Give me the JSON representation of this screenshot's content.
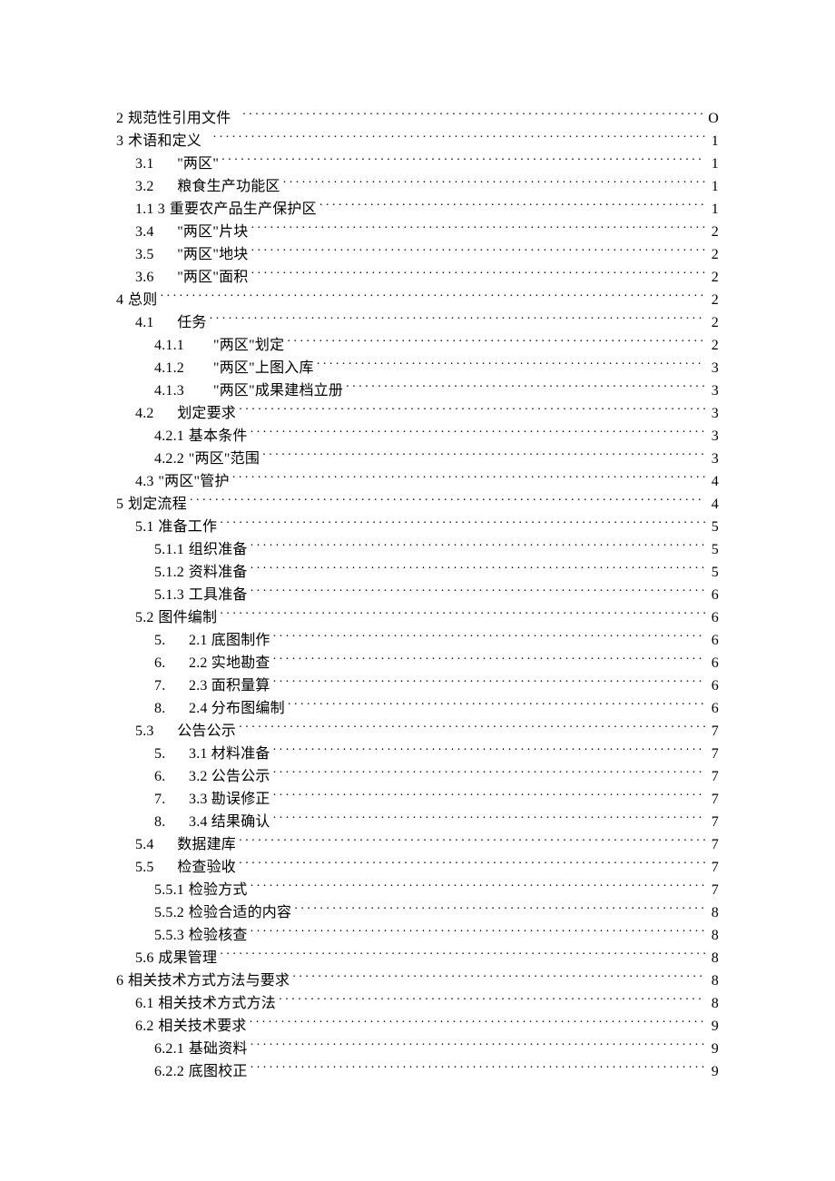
{
  "toc": [
    {
      "level": 1,
      "num": "2",
      "title": "规范性引用文件",
      "page": "O",
      "padTitle": true
    },
    {
      "level": 1,
      "num": "3",
      "title": "术语和定义",
      "page": "1",
      "padTitle": true
    },
    {
      "level": 2,
      "num": "3.1",
      "title": "\"两区\"",
      "page": "1",
      "spacedNum": true
    },
    {
      "level": 2,
      "num": "3.2",
      "title": "粮食生产功能区",
      "page": "1",
      "spacedNum": true
    },
    {
      "level": 2,
      "num": "1.1 3",
      "title": "重要农产品生产保护区",
      "page": "1"
    },
    {
      "level": 2,
      "num": "3.4",
      "title": "\"两区\"片块",
      "page": "2",
      "spacedNum": true
    },
    {
      "level": 2,
      "num": "3.5",
      "title": "\"两区\"地块",
      "page": "2",
      "spacedNum": true
    },
    {
      "level": 2,
      "num": "3.6",
      "title": "\"两区\"面积",
      "page": "2",
      "spacedNum": true
    },
    {
      "level": 1,
      "num": "4",
      "title": "总则",
      "page": "2"
    },
    {
      "level": 2,
      "num": "4.1",
      "title": "任务",
      "page": "2",
      "spacedNum": true
    },
    {
      "level": 3,
      "num": "4.1.1",
      "title": "\"两区\"划定",
      "page": "2",
      "subSpaced": true
    },
    {
      "level": 3,
      "num": "4.1.2",
      "title": "\"两区\"上图入库",
      "page": "3",
      "subSpaced": true
    },
    {
      "level": 3,
      "num": "4.1.3",
      "title": "\"两区\"成果建档立册",
      "page": "3",
      "subSpaced": true
    },
    {
      "level": 2,
      "num": "4.2",
      "title": "划定要求",
      "page": "3",
      "spacedNum": true
    },
    {
      "level": 3,
      "num": "4.2.1",
      "title": "基本条件",
      "page": "3"
    },
    {
      "level": 3,
      "num": "4.2.2",
      "title": "\"两区\"范围",
      "page": "3"
    },
    {
      "level": 2,
      "num": "4.3",
      "title": "\"两区\"管护",
      "page": "4"
    },
    {
      "level": 1,
      "num": "5",
      "title": "划定流程",
      "page": "4"
    },
    {
      "level": 2,
      "num": "5.1",
      "title": "准备工作",
      "page": "5"
    },
    {
      "level": 3,
      "num": "5.1.1",
      "title": "组织准备",
      "page": "5"
    },
    {
      "level": 3,
      "num": "5.1.2",
      "title": "资料准备",
      "page": "5"
    },
    {
      "level": 3,
      "num": "5.1.3",
      "title": "工具准备",
      "page": "6"
    },
    {
      "level": 2,
      "num": "5.2",
      "title": "图件编制",
      "page": "6"
    },
    {
      "level": 3,
      "num": "5.",
      "title": "2.1 底图制作",
      "page": "6",
      "spacedNum": true
    },
    {
      "level": 3,
      "num": "6.",
      "title": "2.2 实地勘查",
      "page": "6",
      "spacedNum": true
    },
    {
      "level": 3,
      "num": "7.",
      "title": "2.3 面积量算",
      "page": "6",
      "spacedNum": true
    },
    {
      "level": 3,
      "num": "8.",
      "title": "2.4 分布图编制",
      "page": "6",
      "spacedNum": true
    },
    {
      "level": 2,
      "num": "5.3",
      "title": "公告公示",
      "page": "7",
      "spacedNum": true
    },
    {
      "level": 3,
      "num": "5.",
      "title": "3.1 材料准备",
      "page": "7",
      "spacedNum": true
    },
    {
      "level": 3,
      "num": "6.",
      "title": "3.2 公告公示",
      "page": "7",
      "spacedNum": true
    },
    {
      "level": 3,
      "num": "7.",
      "title": "3.3 勘误修正",
      "page": "7",
      "spacedNum": true
    },
    {
      "level": 3,
      "num": "8.",
      "title": "3.4 结果确认",
      "page": "7",
      "spacedNum": true
    },
    {
      "level": 2,
      "num": "5.4",
      "title": "数据建库",
      "page": "7",
      "spacedNum": true
    },
    {
      "level": 2,
      "num": "5.5",
      "title": "检查验收",
      "page": "7",
      "spacedNum": true
    },
    {
      "level": 3,
      "num": "5.5.1",
      "title": "检验方式",
      "page": "7"
    },
    {
      "level": 3,
      "num": "5.5.2",
      "title": "检验合适的内容",
      "page": "8"
    },
    {
      "level": 3,
      "num": "5.5.3",
      "title": "检验核查",
      "page": "8"
    },
    {
      "level": 2,
      "num": "5.6",
      "title": "成果管理",
      "page": "8"
    },
    {
      "level": 1,
      "num": "6",
      "title": "相关技术方式方法与要求",
      "page": "8"
    },
    {
      "level": 2,
      "num": "6.1",
      "title": "相关技术方式方法",
      "page": "8"
    },
    {
      "level": 2,
      "num": "6.2",
      "title": "相关技术要求",
      "page": "9"
    },
    {
      "level": 3,
      "num": "6.2.1",
      "title": "基础资料",
      "page": "9"
    },
    {
      "level": 3,
      "num": "6.2.2",
      "title": "底图校正",
      "page": "9"
    }
  ]
}
